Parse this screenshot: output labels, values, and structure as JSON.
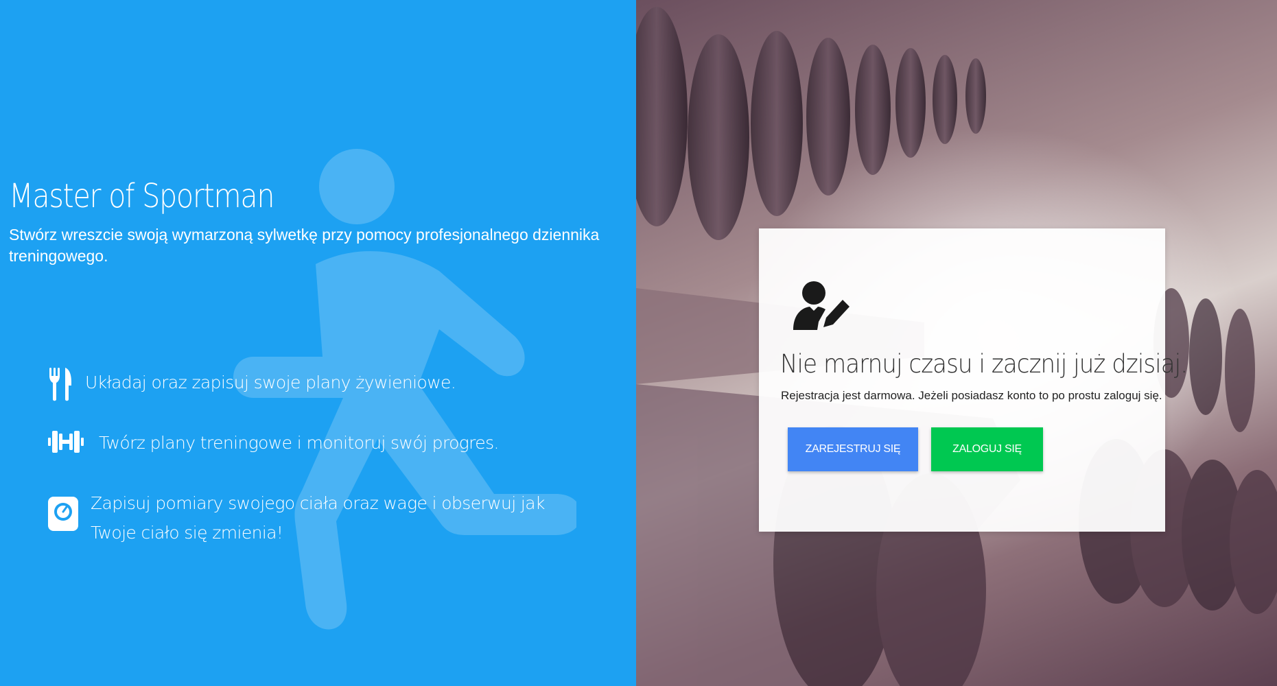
{
  "app": {
    "title": "Master of Sportman",
    "subtitle": "Stwórz wreszcie swoją wymarzoną sylwetkę przy pomocy profesjonalnego dziennika treningowego."
  },
  "features": [
    {
      "icon": "utensils-icon",
      "text": "Układaj oraz zapisuj swoje plany żywieniowe."
    },
    {
      "icon": "dumbbell-icon",
      "text": "Twórz plany treningowe i monitoruj swój progres."
    },
    {
      "icon": "weight-scale-icon",
      "text": "Zapisuj pomiary swojego ciała oraz wage i obserwuj jak Twoje ciało się zmienia!"
    }
  ],
  "card": {
    "icon": "user-edit-icon",
    "heading": "Nie marnuj czasu i zacznij już dzisiaj.",
    "text": "Rejestracja jest darmowa. Jeżeli posiadasz konto to po prostu zaloguj się.",
    "register_label": "ZAREJESTRUJ SIĘ",
    "login_label": "ZALOGUJ SIĘ"
  },
  "colors": {
    "left_panel_bg": "#1da1f2",
    "register_button": "#4285f4",
    "login_button": "#00c851"
  }
}
